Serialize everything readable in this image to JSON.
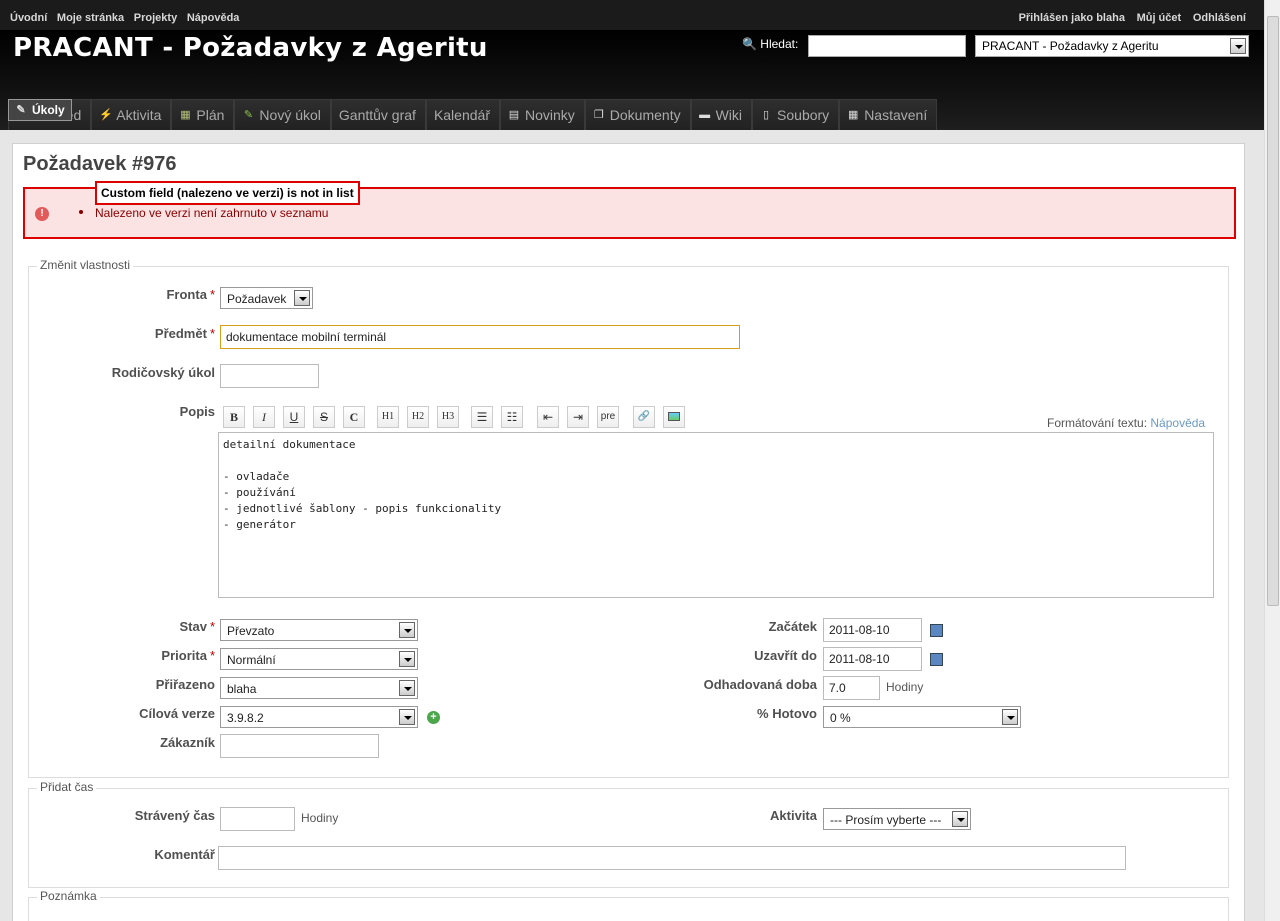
{
  "top_nav": {
    "links": [
      "Úvodní",
      "Moje stránka",
      "Projekty",
      "Nápověda"
    ],
    "logged_in": "Přihlášen jako blaha",
    "my_account": "Můj účet",
    "logout": "Odhlášení"
  },
  "header": {
    "title": "PRACANT - Požadavky z Ageritu",
    "search_label": "Hledat:",
    "project_select": "PRACANT - Požadavky z Ageritu"
  },
  "tabs": [
    {
      "label": "Přehled",
      "icon": "doc-icon"
    },
    {
      "label": "Aktivita",
      "icon": "lightning-icon"
    },
    {
      "label": "Plán",
      "icon": "map-icon"
    },
    {
      "label": "Úkoly",
      "icon": "ticket-icon",
      "selected": true
    },
    {
      "label": "Nový úkol",
      "icon": "new-ticket-icon"
    },
    {
      "label": "Ganttův graf",
      "icon": ""
    },
    {
      "label": "Kalendář",
      "icon": ""
    },
    {
      "label": "Novinky",
      "icon": "news-icon"
    },
    {
      "label": "Dokumenty",
      "icon": "documents-icon"
    },
    {
      "label": "Wiki",
      "icon": "wiki-icon"
    },
    {
      "label": "Soubory",
      "icon": "files-icon"
    },
    {
      "label": "Nastavení",
      "icon": "settings-icon"
    }
  ],
  "page": {
    "title": "Požadavek #976",
    "error_tooltip": "Custom field (nalezeno ve verzi) is not in list",
    "error_message": "Nalezeno ve verzi není zahrnuto v seznamu"
  },
  "form": {
    "legend": "Změnit vlastnosti",
    "fronta_label": "Fronta",
    "fronta_value": "Požadavek",
    "predmet_label": "Předmět",
    "predmet_value": "dokumentace mobilní terminál",
    "rodic_label": "Rodičovský úkol",
    "popis_label": "Popis",
    "formatting_label": "Formátování textu:",
    "formatting_link": "Nápověda",
    "popis_value": "detailní dokumentace\n\n- ovladače\n- používání\n- jednotlivé šablony - popis funkcionality\n- generátor",
    "toolbar": [
      "B",
      "I",
      "U",
      "S",
      "C",
      "H1",
      "H2",
      "H3",
      "ul",
      "ol",
      "indent-left",
      "indent-right",
      "pre",
      "link",
      "image"
    ],
    "stav_label": "Stav",
    "stav_value": "Převzato",
    "priorita_label": "Priorita",
    "priorita_value": "Normální",
    "prirazeno_label": "Přiřazeno",
    "prirazeno_value": "blaha",
    "cilova_label": "Cílová verze",
    "cilova_value": "3.9.8.2",
    "zakaznik_label": "Zákazník",
    "zacatek_label": "Začátek",
    "zacatek_value": "2011-08-10",
    "uzavrit_label": "Uzavřít do",
    "uzavrit_value": "2011-08-10",
    "odhad_label": "Odhadovaná doba",
    "odhad_value": "7.0",
    "hodiny": "Hodiny",
    "hotovo_label": "% Hotovo",
    "hotovo_value": "0 %"
  },
  "time": {
    "legend": "Přidat čas",
    "straveny_label": "Strávený čas",
    "hodiny": "Hodiny",
    "aktivita_label": "Aktivita",
    "aktivita_value": "--- Prosím vyberte ---",
    "komentar_label": "Komentář"
  },
  "note": {
    "legend": "Poznámka"
  }
}
